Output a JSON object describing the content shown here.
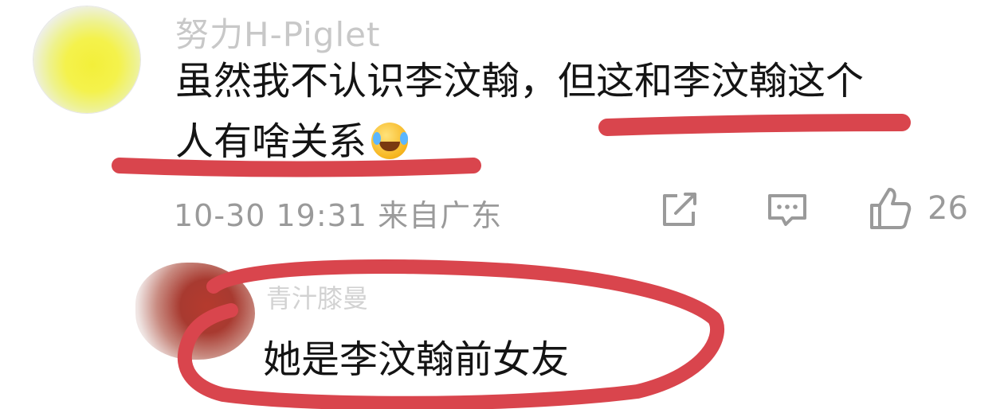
{
  "comment": {
    "username": "努力H-Piglet",
    "text_line_1": "虽然我不认识李汶翰，但这和李汶翰这个",
    "text_line_2": "人有啥关系",
    "emoji": "laughing-crying-emoji",
    "timestamp": "10-30 19:31  来自广东",
    "like_count": "26",
    "icons": [
      "share-icon",
      "comment-icon",
      "thumbs-up-icon"
    ]
  },
  "reply": {
    "username": "青汁膝曼",
    "text": "她是李汶翰前女友"
  },
  "annotation_color": "#d9454d"
}
